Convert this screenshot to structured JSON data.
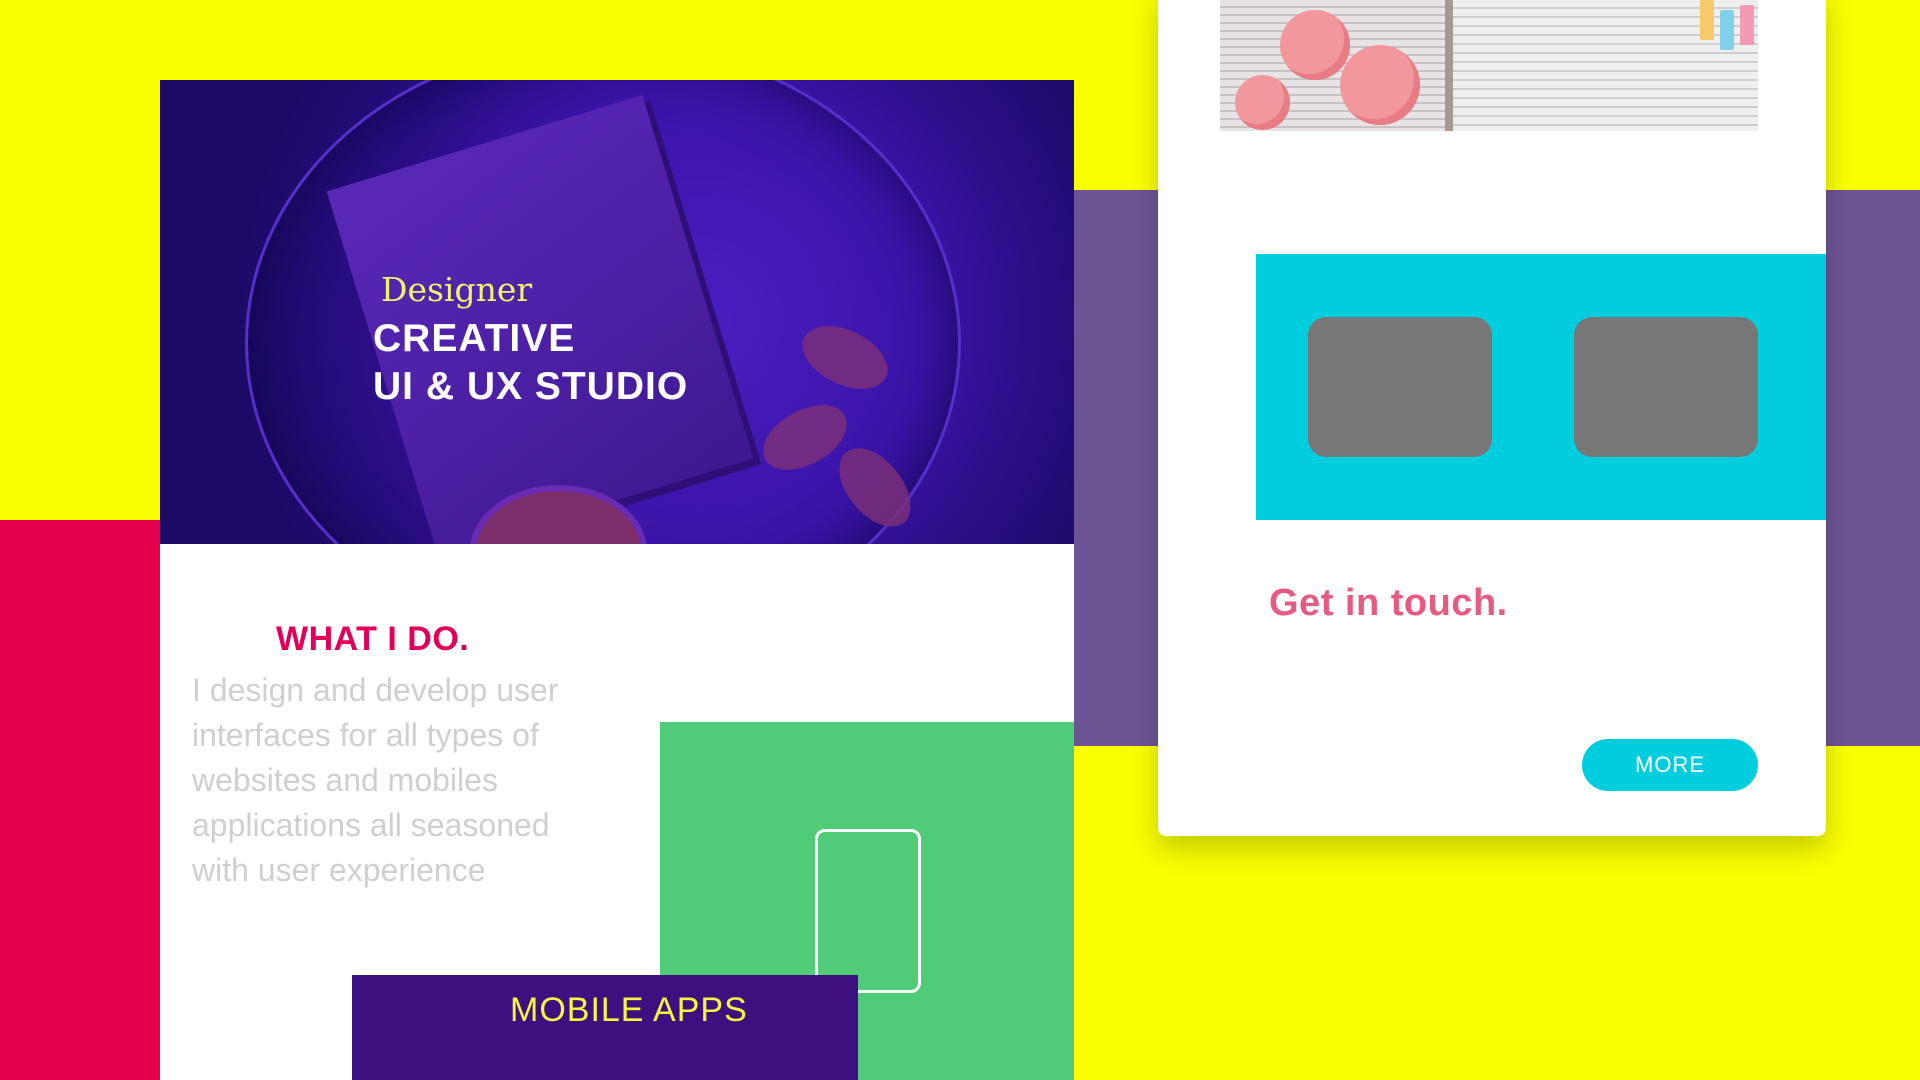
{
  "hero": {
    "kicker": "Designer",
    "title_line1": "CREATIVE",
    "title_line2": "UI & UX STUDIO"
  },
  "about": {
    "heading": "WHAT I DO.",
    "body": "I design and develop user interfaces for all types of websites and mobiles applications all seasoned with user experience"
  },
  "services": {
    "mobile_label": "MOBILE  APPS",
    "panel_icon": "phone-outline-icon"
  },
  "contact": {
    "heading": "Get in touch.",
    "more_label": "MORE"
  },
  "colors": {
    "background_yellow": "#f9ff00",
    "accent_pink": "#e5004f",
    "accent_purple": "#6d5495",
    "hero_purple": "#2a0e86",
    "green": "#50cc78",
    "cyan": "#00cedf",
    "contact_pink": "#e65b81",
    "mobile_block": "#3d1080"
  }
}
